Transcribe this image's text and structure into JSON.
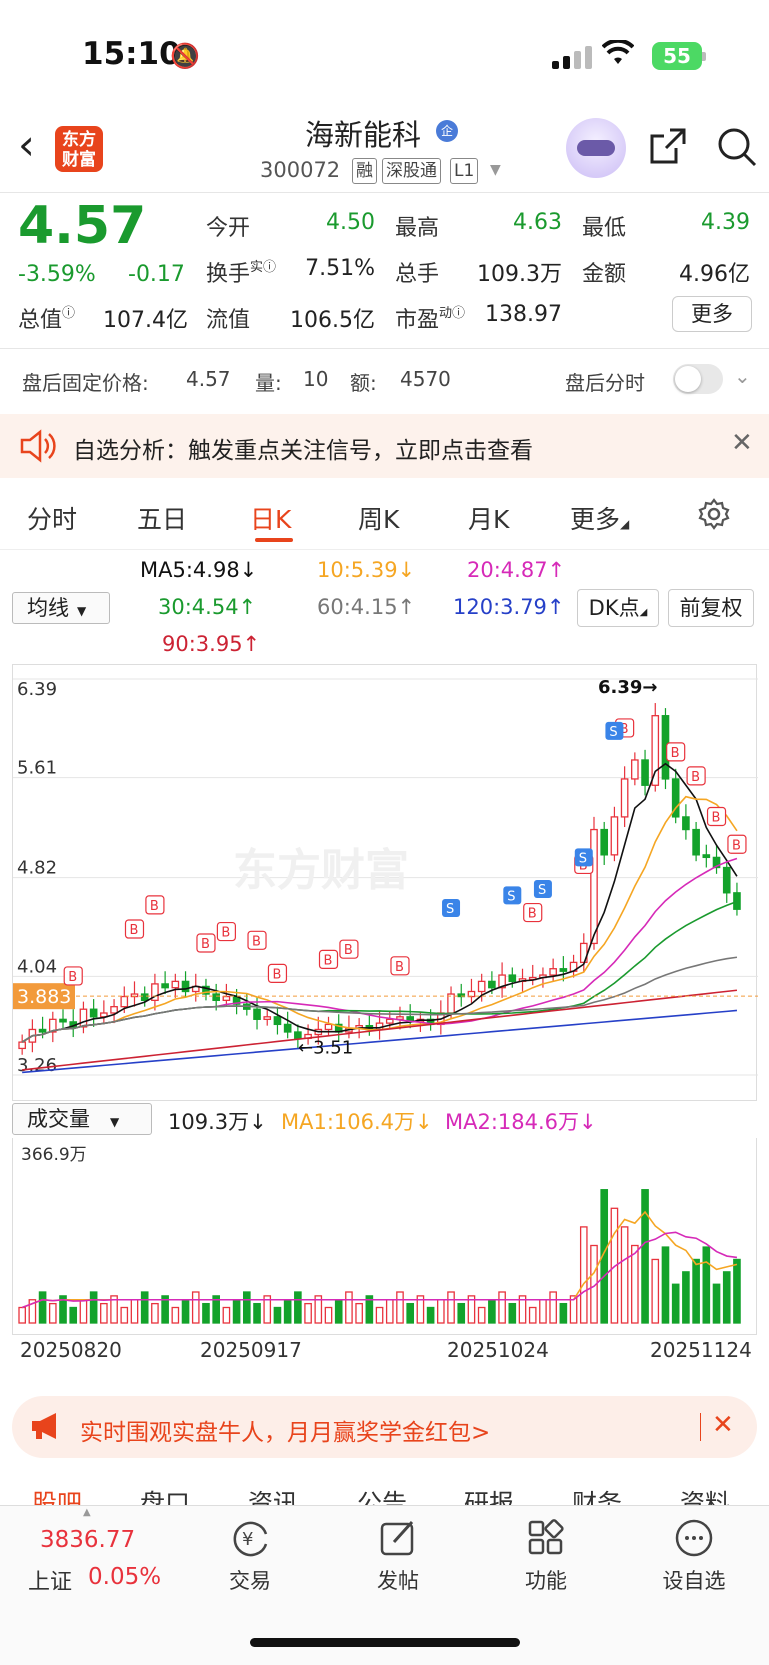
{
  "status": {
    "time": "15:10",
    "battery": "55"
  },
  "header": {
    "logo_text": "东方财富",
    "stock_name": "海新能科",
    "stock_code": "300072",
    "badge": "企",
    "tags": [
      "融",
      "深股通",
      "L1"
    ]
  },
  "quote": {
    "price": "4.57",
    "change_pct": "-3.59%",
    "change_abs": "-0.17",
    "open_label": "今开",
    "open": "4.50",
    "high_label": "最高",
    "high": "4.63",
    "low_label": "最低",
    "low": "4.39",
    "turnover_label": "换手",
    "turnover_sup": "实",
    "turnover": "7.51%",
    "volume_label": "总手",
    "volume": "109.3万",
    "amount_label": "金额",
    "amount": "4.96亿",
    "mktcap_label": "总值",
    "mktcap": "107.4亿",
    "float_label": "流值",
    "float": "106.5亿",
    "pe_label": "市盈",
    "pe_sup": "动",
    "pe": "138.97",
    "more_label": "更多"
  },
  "after_hours": {
    "price_label": "盘后固定价格:",
    "price": "4.57",
    "vol_label": "量:",
    "vol": "10",
    "amt_label": "额:",
    "amt": "4570",
    "toggle_label": "盘后分时"
  },
  "alert": {
    "text": "自选分析：触发重点关注信号，立即点击查看"
  },
  "tabs": [
    "分时",
    "五日",
    "日K",
    "周K",
    "月K",
    "更多"
  ],
  "ma_bar": {
    "select": "均线",
    "ma5": "MA5:4.98↓",
    "ma10": "10:5.39↓",
    "ma20": "20:4.87↑",
    "ma30": "30:4.54↑",
    "ma60": "60:4.15↑",
    "ma120": "120:3.79↑",
    "ma90": "90:3.95↑",
    "dk_label": "DK点",
    "fq_label": "前复权"
  },
  "colors": {
    "up": "#e8323c",
    "down": "#13a22b",
    "ma5": "#111111",
    "ma10": "#f5a623",
    "ma20": "#d62ab8",
    "ma30": "#1a9a2e",
    "ma60": "#777777",
    "ma120": "#2640c8",
    "ma90": "#cc2233"
  },
  "chart_data": {
    "type": "candlestick",
    "y_ticks": [
      "6.39",
      "5.61",
      "4.82",
      "4.04",
      "3.26"
    ],
    "ylim": [
      3.26,
      6.39
    ],
    "current_price_tag": "3.883",
    "max_annotation": "6.39",
    "min_annotation": "3.51",
    "watermark": "东方财富",
    "x_ticks": [
      "20250820",
      "20250917",
      "20251024",
      "20251124"
    ],
    "candles_close": [
      3.52,
      3.62,
      3.6,
      3.7,
      3.68,
      3.64,
      3.78,
      3.72,
      3.75,
      3.8,
      3.88,
      3.9,
      3.85,
      3.98,
      3.95,
      4.0,
      3.92,
      3.96,
      3.9,
      3.85,
      3.88,
      3.82,
      3.78,
      3.7,
      3.72,
      3.66,
      3.6,
      3.55,
      3.58,
      3.62,
      3.66,
      3.6,
      3.63,
      3.65,
      3.62,
      3.67,
      3.7,
      3.72,
      3.68,
      3.7,
      3.66,
      3.75,
      3.9,
      3.88,
      3.92,
      4.0,
      3.95,
      4.05,
      4.0,
      4.02,
      4.03,
      4.05,
      4.1,
      4.08,
      4.15,
      4.3,
      5.2,
      5.0,
      5.3,
      5.6,
      5.75,
      5.55,
      6.1,
      5.6,
      5.3,
      5.2,
      5.0,
      4.98,
      4.9,
      4.7,
      4.57
    ],
    "volume": {
      "label": "成交量",
      "current": "109.3万↓",
      "ma1": "MA1:106.4万↓",
      "ma2": "MA2:184.6万↓",
      "max_label": "366.9万"
    }
  },
  "promo": {
    "text": "实时围观实盘牛人，月月赢奖学金红包>"
  },
  "subtabs": [
    "股吧",
    "盘口",
    "资讯",
    "公告",
    "研报",
    "财务",
    "资料"
  ],
  "bottom_nav": {
    "index_value": "3836.77",
    "index_name": "上证",
    "index_change": "0.05%",
    "items": [
      "交易",
      "发帖",
      "功能",
      "设自选"
    ]
  }
}
